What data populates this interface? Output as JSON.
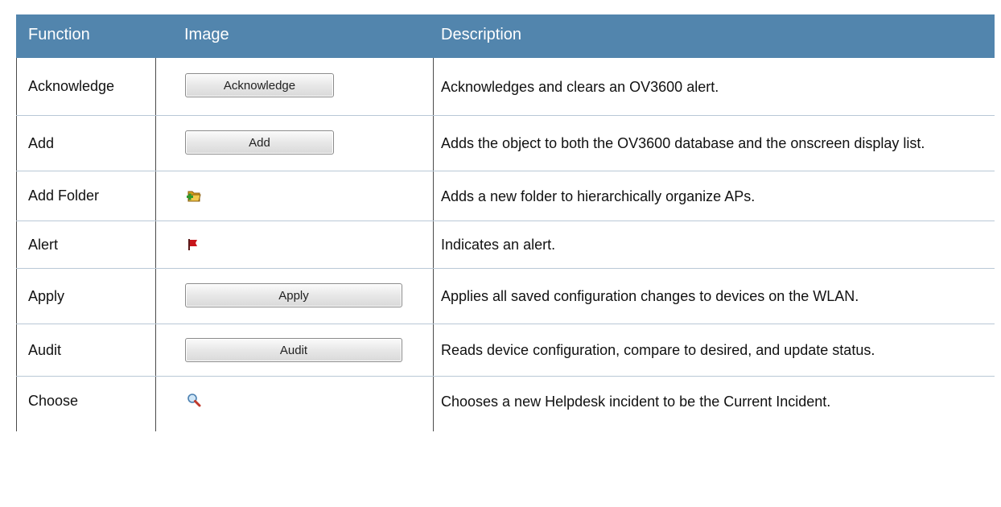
{
  "headers": {
    "function": "Function",
    "image": "Image",
    "description": "Description"
  },
  "rows": [
    {
      "function": "Acknowledge",
      "image_type": "button",
      "image_label": "Acknowledge",
      "description": "Acknowledges and clears an OV3600 alert."
    },
    {
      "function": "Add",
      "image_type": "button",
      "image_label": "Add",
      "description": "Adds the object to both the OV3600 database and the onscreen display list."
    },
    {
      "function": "Add Folder",
      "image_type": "icon",
      "icon": "add-folder-icon",
      "description": "Adds a new folder to hierarchically organize APs."
    },
    {
      "function": "Alert",
      "image_type": "icon",
      "icon": "red-flag-icon",
      "description": "Indicates an alert."
    },
    {
      "function": "Apply",
      "image_type": "button",
      "image_label": "Apply",
      "description": "Applies all saved configuration changes to devices on the WLAN."
    },
    {
      "function": "Audit",
      "image_type": "button",
      "image_label": "Audit",
      "description": "Reads device configuration, compare to desired, and update status."
    },
    {
      "function": "Choose",
      "image_type": "icon",
      "icon": "magnifier-icon",
      "description": "Chooses a new Helpdesk incident to be the Current Incident."
    }
  ],
  "colors": {
    "header_bg": "#5285ad",
    "header_text": "#ffffff",
    "row_divider": "#b9c8d6"
  }
}
